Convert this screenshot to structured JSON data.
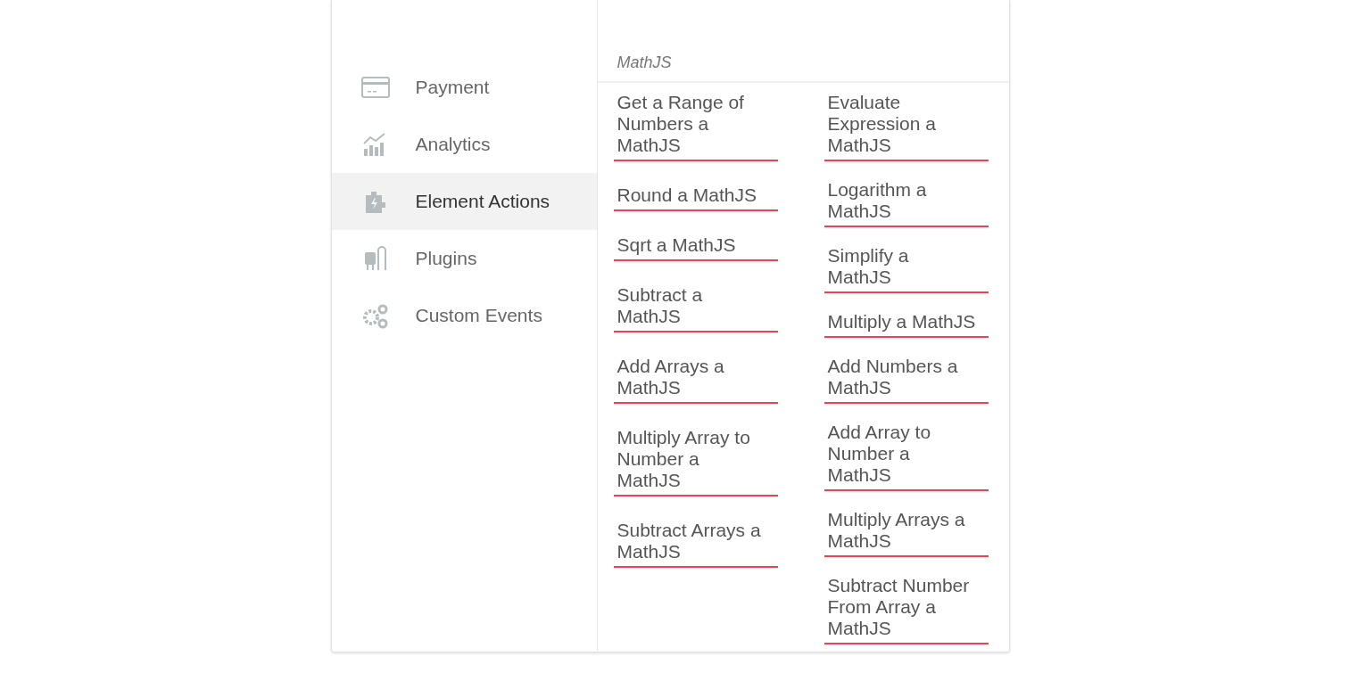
{
  "sidebar": {
    "items": [
      {
        "label": "Payment",
        "selected": false
      },
      {
        "label": "Analytics",
        "selected": false
      },
      {
        "label": "Element Actions",
        "selected": true
      },
      {
        "label": "Plugins",
        "selected": false
      },
      {
        "label": "Custom Events",
        "selected": false
      }
    ]
  },
  "section": {
    "title": "MathJS",
    "columns": [
      {
        "items": [
          "Get a Range of Numbers a MathJS",
          "Round a MathJS",
          "Sqrt a MathJS",
          "Subtract a MathJS",
          "Add Arrays a MathJS",
          "Multiply Array to Number a MathJS",
          "Subtract Arrays a MathJS"
        ]
      },
      {
        "items": [
          "Evaluate Expression a MathJS",
          "Logarithm a MathJS",
          "Simplify a MathJS",
          "Multiply a MathJS",
          "Add Numbers a MathJS",
          "Add Array to Number a MathJS",
          "Multiply Arrays a MathJS",
          "Subtract Number From Array a MathJS"
        ]
      }
    ]
  }
}
